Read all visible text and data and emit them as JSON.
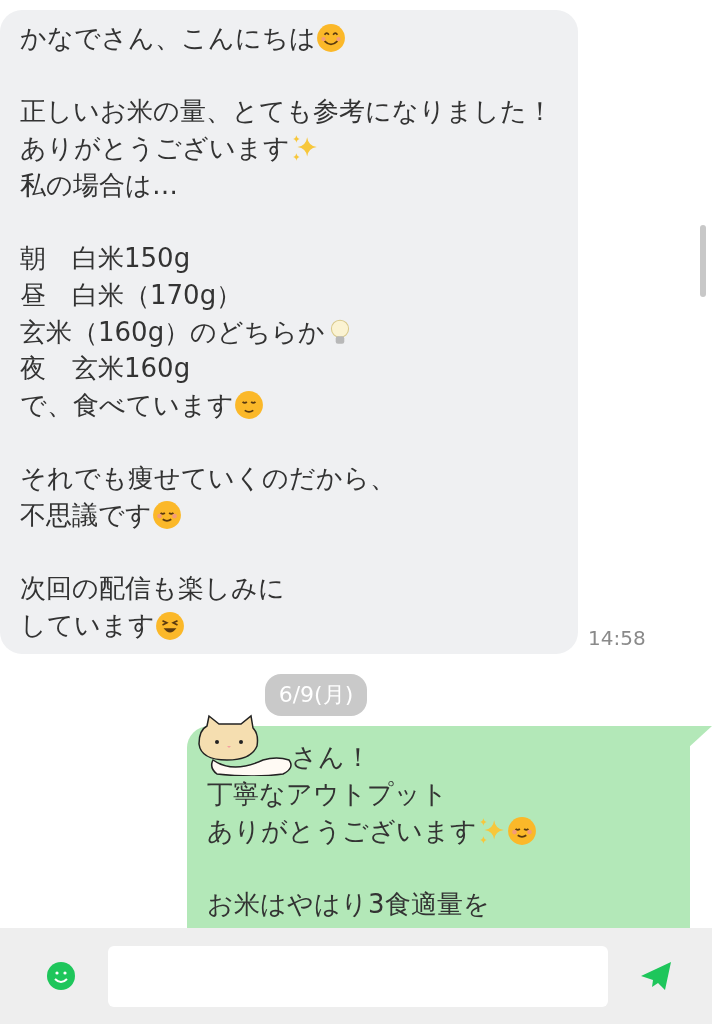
{
  "messages": [
    {
      "kind": "received",
      "time": "14:58",
      "paragraphs": [
        [
          {
            "text": "かなでさん、こんにちは",
            "icons": [
              {
                "kind": "smile"
              }
            ]
          }
        ],
        [
          {
            "text": "正しいお米の量、とても参考になりました！"
          },
          {
            "text": "ありがとうございます",
            "icons": [
              {
                "kind": "sparkles"
              }
            ]
          },
          {
            "text": "私の場合は…"
          }
        ],
        [
          {
            "text": "朝　白米150g"
          },
          {
            "text": "昼　白米（170g）"
          },
          {
            "text": "玄米（160g）のどちらか",
            "icons": [
              {
                "kind": "bulb"
              }
            ]
          },
          {
            "text": "夜　玄米160g"
          },
          {
            "text": "で、食べています",
            "icons": [
              {
                "kind": "relieved"
              }
            ]
          }
        ],
        [
          {
            "text": "それでも痩せていくのだから、"
          },
          {
            "text": "不思議です",
            "icons": [
              {
                "kind": "smiling"
              }
            ]
          }
        ],
        [
          {
            "text": "次回の配信も楽しみに"
          },
          {
            "text": "しています",
            "icons": [
              {
                "kind": "laughing"
              }
            ]
          }
        ]
      ]
    },
    {
      "kind": "date",
      "text": "6/9(月)"
    },
    {
      "kind": "sent",
      "sticker": true,
      "paragraphs": [
        [
          {
            "text": "さん！"
          },
          {
            "text": "丁寧なアウトプット"
          },
          {
            "text": "ありがとうございます",
            "icons": [
              {
                "kind": "sparkles"
              },
              {
                "kind": "smiling"
              }
            ]
          }
        ],
        [
          {
            "text": "お米はやはり3食適量を"
          }
        ]
      ]
    }
  ]
}
